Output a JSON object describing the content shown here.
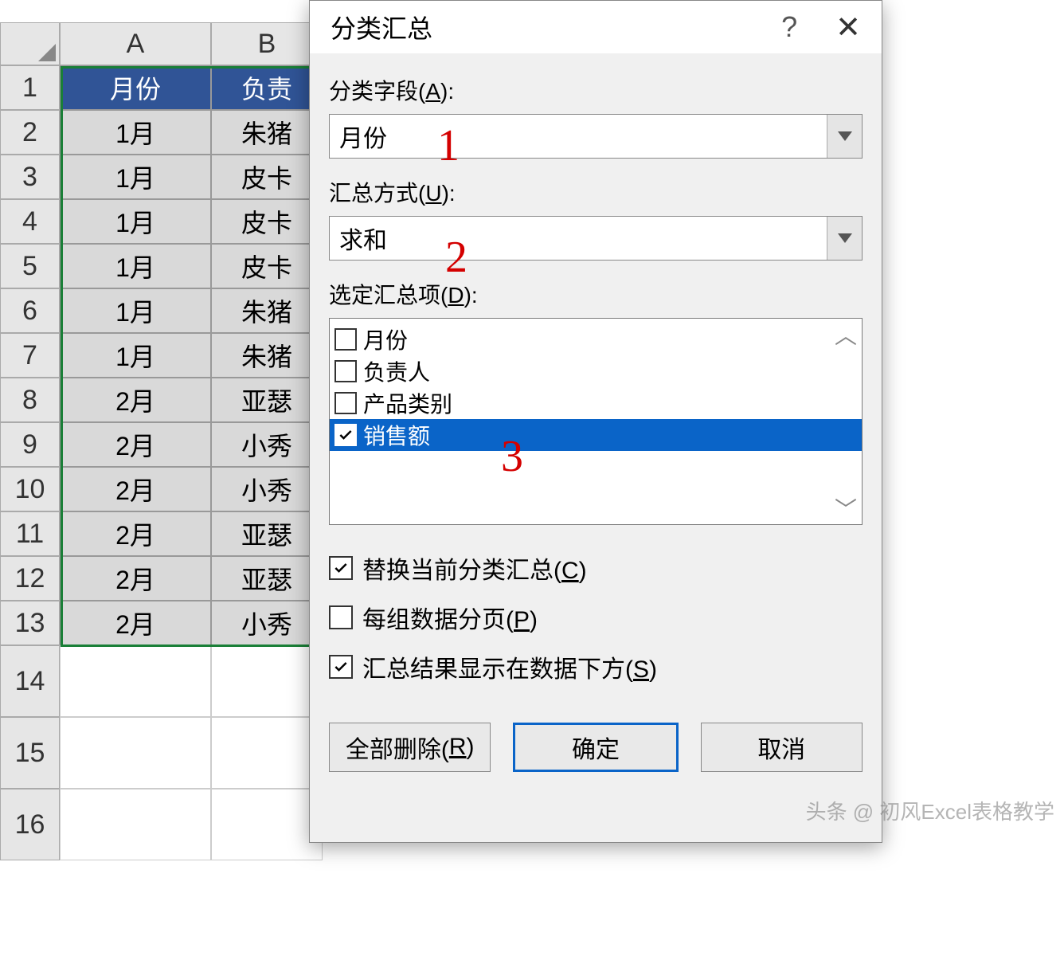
{
  "sheet": {
    "col_labels": [
      "A",
      "B"
    ],
    "row_labels": [
      "1",
      "2",
      "3",
      "4",
      "5",
      "6",
      "7",
      "8",
      "9",
      "10",
      "11",
      "12",
      "13",
      "14",
      "15",
      "16"
    ],
    "header": {
      "a": "月份",
      "b": "负责"
    },
    "rows": [
      {
        "a": "1月",
        "b": "朱猪"
      },
      {
        "a": "1月",
        "b": "皮卡"
      },
      {
        "a": "1月",
        "b": "皮卡"
      },
      {
        "a": "1月",
        "b": "皮卡"
      },
      {
        "a": "1月",
        "b": "朱猪"
      },
      {
        "a": "1月",
        "b": "朱猪"
      },
      {
        "a": "2月",
        "b": "亚瑟"
      },
      {
        "a": "2月",
        "b": "小秀"
      },
      {
        "a": "2月",
        "b": "小秀"
      },
      {
        "a": "2月",
        "b": "亚瑟"
      },
      {
        "a": "2月",
        "b": "亚瑟"
      },
      {
        "a": "2月",
        "b": "小秀"
      }
    ]
  },
  "dialog": {
    "title": "分类汇总",
    "field_label": "分类字段(A):",
    "field_value": "月份",
    "method_label": "汇总方式(U):",
    "method_value": "求和",
    "items_label": "选定汇总项(D):",
    "items": [
      {
        "label": "月份",
        "checked": false,
        "selected": false
      },
      {
        "label": "负责人",
        "checked": false,
        "selected": false
      },
      {
        "label": "产品类别",
        "checked": false,
        "selected": false
      },
      {
        "label": "销售额",
        "checked": true,
        "selected": true
      }
    ],
    "opt_replace": "替换当前分类汇总(C)",
    "opt_pagebreak": "每组数据分页(P)",
    "opt_below": "汇总结果显示在数据下方(S)",
    "opt_replace_checked": true,
    "opt_pagebreak_checked": false,
    "opt_below_checked": true,
    "btn_removeall": "全部删除(R)",
    "btn_ok": "确定",
    "btn_cancel": "取消"
  },
  "annotations": {
    "n1": "1",
    "n2": "2",
    "n3": "3"
  },
  "watermark": "头条 @ 初风Excel表格教学"
}
